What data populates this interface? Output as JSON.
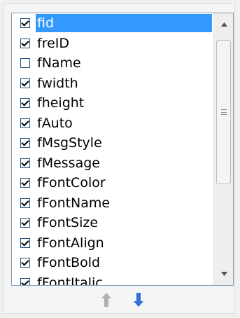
{
  "fields": [
    {
      "label": "fid",
      "checked": true,
      "selected": true
    },
    {
      "label": "freID",
      "checked": true
    },
    {
      "label": "fName",
      "checked": false
    },
    {
      "label": "fwidth",
      "checked": true
    },
    {
      "label": "fheight",
      "checked": true
    },
    {
      "label": "fAuto",
      "checked": true
    },
    {
      "label": "fMsgStyle",
      "checked": true
    },
    {
      "label": "fMessage",
      "checked": true
    },
    {
      "label": "fFontColor",
      "checked": true
    },
    {
      "label": "fFontName",
      "checked": true
    },
    {
      "label": "fFontSize",
      "checked": true
    },
    {
      "label": "fFontAlign",
      "checked": true
    },
    {
      "label": "fFontBold",
      "checked": true
    },
    {
      "label": "fFontItalic",
      "checked": true
    }
  ],
  "controls": {
    "move_up_icon": "arrow-up-icon",
    "move_down_icon": "arrow-down-icon",
    "up_color": "#b0b0b0",
    "down_color": "#2f6fd6"
  }
}
